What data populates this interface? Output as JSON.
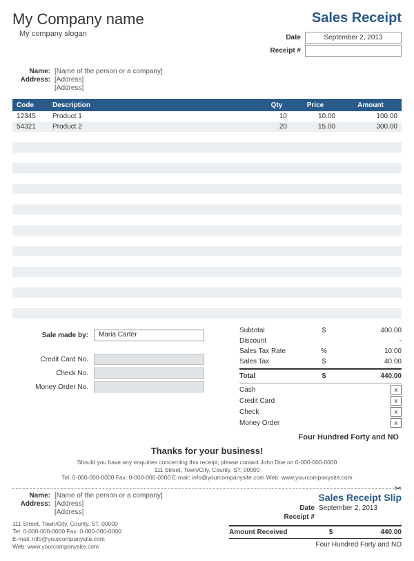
{
  "company": {
    "name": "My Company name",
    "slogan": "My company slogan"
  },
  "title": "Sales Receipt",
  "meta": {
    "date_label": "Date",
    "date": "September 2, 2013",
    "receipt_label": "Receipt #",
    "receipt": ""
  },
  "customer": {
    "name_label": "Name:",
    "name": "[Name of the person or a company]",
    "addr_label": "Address:",
    "addr1": "[Address]",
    "addr2": "[Address]"
  },
  "columns": {
    "code": "Code",
    "desc": "Description",
    "qty": "Qty",
    "price": "Price",
    "amount": "Amount"
  },
  "items": [
    {
      "code": "12345",
      "desc": "Product 1",
      "qty": "10",
      "price": "10.00",
      "amount": "100.00"
    },
    {
      "code": "54321",
      "desc": "Product 2",
      "qty": "20",
      "price": "15.00",
      "amount": "300.00"
    }
  ],
  "blank_rows": 18,
  "sale_by": {
    "label": "Sale made by:",
    "value": "Maria Carter"
  },
  "payment_ref": {
    "cc_label": "Credit Card No.",
    "check_label": "Check No.",
    "mo_label": "Money Order No."
  },
  "totals": {
    "subtotal_label": "Subtotal",
    "subtotal": "400.00",
    "discount_label": "Discount",
    "discount": "-",
    "taxrate_label": "Sales Tax Rate",
    "taxrate": "10.00",
    "taxrate_sym": "%",
    "tax_label": "Sales Tax",
    "tax": "40.00",
    "total_label": "Total",
    "total": "440.00",
    "currency": "$"
  },
  "methods": {
    "cash": "Cash",
    "cc": "Credit Card",
    "check": "Check",
    "mo": "Money Order",
    "mark": "x"
  },
  "words": "Four Hundred Forty and NO",
  "thanks": "Thanks for your business!",
  "footer": {
    "line1": "Should you have any enquiries concerning this receipt, please contact John Doe on 0-000-000-0000",
    "line2": "111 Street, Town/City, County, ST, 00000",
    "line3": "Tel: 0-000-000-0000 Fax: 0-000-000-0000 E-mail: info@yourcompanysite.com Web: www.yourcompanysite.com"
  },
  "slip": {
    "title": "Sales Receipt Slip",
    "date": "September 2, 2013",
    "amt_label": "Amount Received",
    "amt": "440.00",
    "words": "Four Hundred Forty and NO",
    "footer_addr": "111 Street, Town/City, County, ST, 00000",
    "footer_tel": "Tel: 0-000-000-0000 Fax: 0-000-000-0000",
    "footer_email": "E-mail: info@yourcompanysite.com",
    "footer_web": "Web: www.yourcompanysite.com"
  }
}
